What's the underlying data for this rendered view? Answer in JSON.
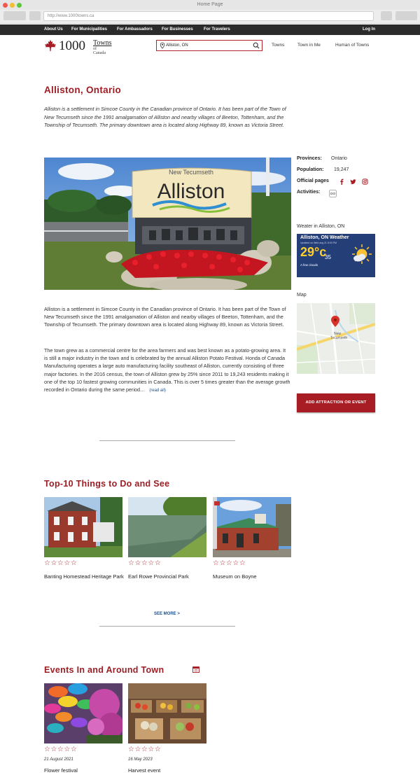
{
  "browser": {
    "title": "Home Page",
    "url": "http://www.1000towns.ca"
  },
  "nav": {
    "items": [
      "About Us",
      "For Municipalities",
      "For Ambassadors",
      "For Businesses",
      "For Travelers"
    ],
    "login": "Log In"
  },
  "logo": {
    "number": "1000",
    "towns": "Towns",
    "of_canada": "of Canada"
  },
  "search": {
    "value": "Alliston, ON"
  },
  "top_links": [
    "Towns",
    "Town in Me",
    "Human of Towns"
  ],
  "town": {
    "title": "Alliston, Ontario",
    "intro": "Alliston is a settlement in Simcoe County in the Canadian province of Ontario. It has been part of the Town of New Tecumseth since the 1991 amalgamation of Alliston and nearby villages of Beeton, Tottenham, and the Township of Tecumseth. The primary downtown area is located along Highway 89, known as Victoria Street.",
    "sign_top": "New Tecumseth",
    "sign_name": "Alliston",
    "paragraph1": "Alliston is a settlement in Simcoe County in the Canadian province of Ontario. It has been part of the Town of New Tecumseth since the 1991 amalgamation of Alliston and nearby villages of Beeton, Tottenham, and the Township of Tecumseth. The primary downtown area is located along Highway 89, known as Victoria Street.",
    "paragraph2": "The town grew as a commercial centre for the area farmers and was best known as a potato-growing area. It is still a major industry in the town and is celebrated by the annual Alliston Potato Festival. Honda of Canada Manufacturing operates a large auto manufacturing facility southeast of Alliston, currently consisting of three major factories. In the 2016 census, the town of Alliston grew by 25% since 2011 to 19,243 residents making it one of the top 10 fastest growing communities in Canada. This is over 5 times greater than the average growth recorded in Ontario during the same period…",
    "read_all": "(read all)"
  },
  "facts": {
    "provinces_label": "Provinces:",
    "provinces_value": "Ontario",
    "population_label": "Population:",
    "population_value": "19,247",
    "official_label": "Official pages",
    "activities_label": "Activities:"
  },
  "weather": {
    "label": "Weater in Alliston, ON",
    "title": "Alliston, ON Weather",
    "updated": "Updated on Wed aug 21 8:00 PM",
    "temp": "29°c",
    "low": "35",
    "description": "A few clouds"
  },
  "map": {
    "label": "Map",
    "town_line1": "New",
    "town_line2": "Tecumseth"
  },
  "cta": {
    "label": "ADD ATTRACTION OR EVENT"
  },
  "things": {
    "title": "Top-10 Things to Do and See",
    "see_more": "SEE MORE  >",
    "stars": "☆☆☆☆☆",
    "items": [
      {
        "name": "Banting Homestead Heritage Park"
      },
      {
        "name": "Earl Rowe Provincial Park"
      },
      {
        "name": "Museum on Boyne"
      }
    ]
  },
  "events": {
    "title": "Events In and Around Town",
    "stars": "☆☆☆☆☆",
    "items": [
      {
        "date": "21 August 2021",
        "name": "Flower festival"
      },
      {
        "date": "16 May 2023",
        "name": "Harvest event"
      }
    ]
  },
  "colors": {
    "brand_red": "#9c1d24",
    "nav_dark": "#2b2b2b",
    "weather_blue": "#243e78",
    "link_blue": "#1f4f8a"
  },
  "icons": [
    "maple-leaf-icon",
    "map-pin-icon",
    "search-icon",
    "facebook-icon",
    "twitter-icon",
    "instagram-icon",
    "activity-icon",
    "sun-cloud-icon",
    "calendar-icon"
  ]
}
